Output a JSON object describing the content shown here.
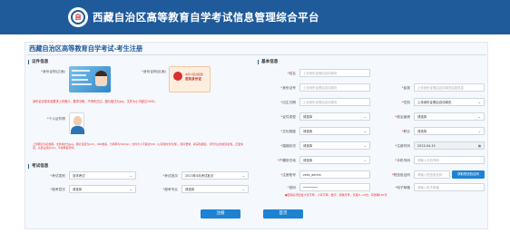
{
  "header": {
    "title": "西藏自治区高等教育自学考试信息管理综合平台"
  },
  "page_title": "西藏自治区高等教育自学考试-考生注册",
  "sections": {
    "cert": "证件信息",
    "basic": "基本信息",
    "exam": "考试信息"
  },
  "cert": {
    "front_label": "身份证明(正面)",
    "back_label": "身份证明(反面)",
    "emblem_line1": "中华人民共和国",
    "emblem_line2": "居民身份证",
    "id_note": "身份证请按本身要求上传照片，要求清晰，不得有白边，图片格式为jpg，文件大小不超过100K。",
    "photo_label": "个人证件照",
    "photo_note": "上传图片为标准照，文件格式为jpg，图片宽度为413，480像素，分辨率为300dpi；文件大小不超过50K（以存储文件为准）。照片要求：着深色服装，背景为白色或浅蓝色，正面免冠，头部占照片2/3，不得佩戴首饰。"
  },
  "exam": {
    "type_label": "考试类别",
    "type_value": "自学考试",
    "batch_label": "考试批次",
    "batch_value": "2023年4月考试批次",
    "level_label": "报考层次",
    "level_value": "请选择",
    "major_label": "报考专业",
    "major_value": "请选择"
  },
  "basic": {
    "name": {
      "label": "姓名",
      "placeholder": "上传身份证照后自动填充"
    },
    "idno": {
      "label": "身份证号",
      "placeholder": "上传身份证照后自动填充"
    },
    "nation": {
      "label": "民族",
      "placeholder": "上传身份证照后自动填充民族信息"
    },
    "birth": {
      "label": "出生日期",
      "placeholder": "上传身份证照后自动填充"
    },
    "gender": {
      "label": "性别",
      "value": "上传身份证照后自动填充"
    },
    "cardtype": {
      "label": "证件类型",
      "value": "请选择"
    },
    "politics": {
      "label": "政治面貌",
      "value": "请选择"
    },
    "edu": {
      "label": "文化程度",
      "value": "请选择"
    },
    "occupation": {
      "label": "职业",
      "value": "请选择"
    },
    "marital": {
      "label": "婚姻状况",
      "value": "请选择"
    },
    "origin": {
      "label": "户籍所在地",
      "value": "请选择"
    },
    "region": {
      "label": "考区",
      "value": "请选择"
    },
    "reg_date_label": "注册时间",
    "reg_date": "2023-04-15",
    "phone_label": "手机号码",
    "phone_placeholder": "请输入手机号码",
    "exam_site": {
      "label": "考点",
      "value": "请选择"
    },
    "address_label": "通讯地址",
    "address_placeholder": "请输入通讯地址",
    "account_label": "注册账号",
    "account_value": "zxks_admin",
    "sms_label": "短信验证码",
    "sms_placeholder": "请输入短信验证码",
    "sms_btn": "获取短信验证码",
    "pwd_label": "密码",
    "pwd_value": "••••••••",
    "pwd_note": "密码必须包含大写字母、小写字母、数字、特殊符号，长度8~16位，有效期180天",
    "email_label": "电子邮箱",
    "email_placeholder": "请输入电子邮箱"
  },
  "buttons": {
    "register": "注册",
    "home": "首页"
  },
  "colors": {
    "header": "#1f5a9b",
    "accent": "#1e82d2",
    "required": "#e33333"
  }
}
